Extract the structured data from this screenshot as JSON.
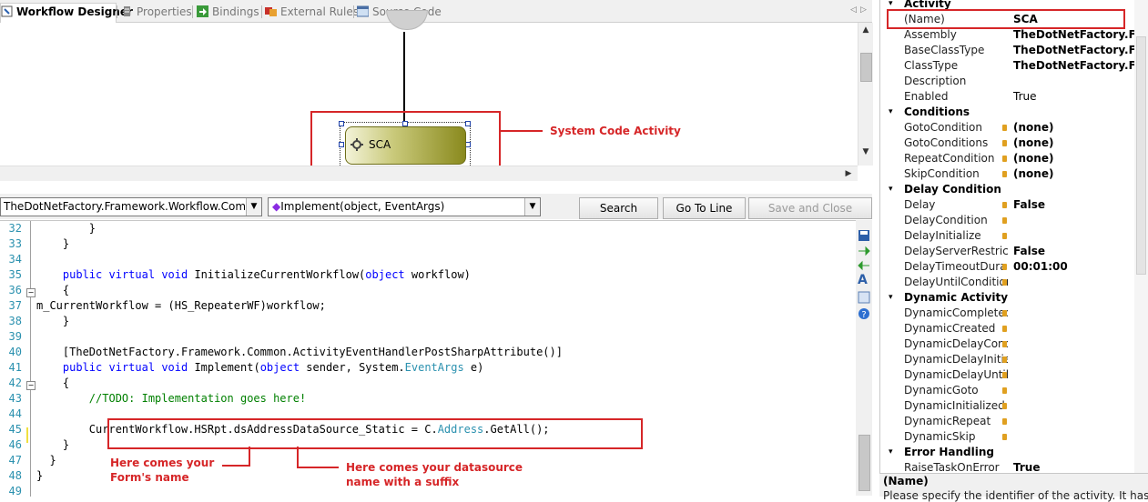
{
  "tabs": [
    {
      "label": "Workflow Designer",
      "active": true
    },
    {
      "label": "Properties",
      "active": false
    },
    {
      "label": "Bindings",
      "active": false
    },
    {
      "label": "External Rules",
      "active": false
    },
    {
      "label": "Source Code",
      "active": false
    }
  ],
  "designer": {
    "activity_label": "SCA",
    "annotation": "System Code Activity"
  },
  "toolbar": {
    "class_combo": "TheDotNetFactory.Framework.Workflow.Comr",
    "method_combo": "Implement(object, EventArgs)",
    "search_label": "Search",
    "goto_label": "Go To Line",
    "save_close_label": "Save and Close"
  },
  "code": {
    "lines": [
      {
        "n": "32",
        "text": "        }"
      },
      {
        "n": "33",
        "text": "    }"
      },
      {
        "n": "34",
        "text": ""
      },
      {
        "n": "35",
        "text": "    public virtual void InitializeCurrentWorkflow(object workflow)"
      },
      {
        "n": "36",
        "text": "    {"
      },
      {
        "n": "37",
        "text": "m_CurrentWorkflow = (HS_RepeaterWF)workflow;"
      },
      {
        "n": "38",
        "text": "    }"
      },
      {
        "n": "39",
        "text": ""
      },
      {
        "n": "40",
        "text": "    [TheDotNetFactory.Framework.Common.ActivityEventHandlerPostSharpAttribute()]"
      },
      {
        "n": "41",
        "text": "    public virtual void Implement(object sender, System.EventArgs e)"
      },
      {
        "n": "42",
        "text": "    {"
      },
      {
        "n": "43",
        "text": "        //TODO: Implementation goes here!"
      },
      {
        "n": "44",
        "text": ""
      },
      {
        "n": "45",
        "text": "        CurrentWorkflow.HSRpt.dsAddressDataSource_Static = C.Address.GetAll();"
      },
      {
        "n": "46",
        "text": "    }"
      },
      {
        "n": "47",
        "text": "  }"
      },
      {
        "n": "48",
        "text": "}"
      },
      {
        "n": "49",
        "text": ""
      }
    ],
    "annotation_form": "Here comes your\nForm's name",
    "annotation_ds": "Here comes your datasource\nname with a suffix"
  },
  "properties": {
    "rows": [
      {
        "kind": "cat",
        "name": "Activity"
      },
      {
        "kind": "prop",
        "name": "(Name)",
        "value": "SCA",
        "bold": true,
        "lock": false
      },
      {
        "kind": "prop",
        "name": "Assembly",
        "value": "TheDotNetFactory.Fr",
        "bold": true,
        "lock": false
      },
      {
        "kind": "prop",
        "name": "BaseClassType",
        "value": "TheDotNetFactory.Fr",
        "bold": true,
        "lock": false
      },
      {
        "kind": "prop",
        "name": "ClassType",
        "value": "TheDotNetFactory.Fr",
        "bold": true,
        "lock": false
      },
      {
        "kind": "prop",
        "name": "Description",
        "value": "",
        "bold": false,
        "lock": false
      },
      {
        "kind": "prop",
        "name": "Enabled",
        "value": "True",
        "bold": false,
        "lock": false
      },
      {
        "kind": "cat",
        "name": "Conditions"
      },
      {
        "kind": "prop",
        "name": "GotoCondition",
        "value": "(none)",
        "bold": true,
        "lock": true
      },
      {
        "kind": "prop",
        "name": "GotoConditions",
        "value": "(none)",
        "bold": true,
        "lock": true
      },
      {
        "kind": "prop",
        "name": "RepeatCondition",
        "value": "(none)",
        "bold": true,
        "lock": true
      },
      {
        "kind": "prop",
        "name": "SkipCondition",
        "value": "(none)",
        "bold": true,
        "lock": true
      },
      {
        "kind": "cat",
        "name": "Delay Condition"
      },
      {
        "kind": "prop",
        "name": "Delay",
        "value": "False",
        "bold": true,
        "lock": true
      },
      {
        "kind": "prop",
        "name": "DelayCondition",
        "value": "",
        "bold": false,
        "lock": true
      },
      {
        "kind": "prop",
        "name": "DelayInitialize",
        "value": "",
        "bold": false,
        "lock": true
      },
      {
        "kind": "prop",
        "name": "DelayServerRestric",
        "value": "False",
        "bold": true,
        "lock": false
      },
      {
        "kind": "prop",
        "name": "DelayTimeoutDura",
        "value": "00:01:00",
        "bold": true,
        "lock": true
      },
      {
        "kind": "prop",
        "name": "DelayUntilCondition",
        "value": "",
        "bold": false,
        "lock": true
      },
      {
        "kind": "cat",
        "name": "Dynamic Activity"
      },
      {
        "kind": "prop",
        "name": "DynamicCompleted",
        "value": "",
        "bold": false,
        "lock": true
      },
      {
        "kind": "prop",
        "name": "DynamicCreated",
        "value": "",
        "bold": false,
        "lock": true
      },
      {
        "kind": "prop",
        "name": "DynamicDelayCond",
        "value": "",
        "bold": false,
        "lock": true
      },
      {
        "kind": "prop",
        "name": "DynamicDelayInitia",
        "value": "",
        "bold": false,
        "lock": true
      },
      {
        "kind": "prop",
        "name": "DynamicDelayUntil",
        "value": "",
        "bold": false,
        "lock": true
      },
      {
        "kind": "prop",
        "name": "DynamicGoto",
        "value": "",
        "bold": false,
        "lock": true
      },
      {
        "kind": "prop",
        "name": "DynamicInitialized",
        "value": "",
        "bold": false,
        "lock": true
      },
      {
        "kind": "prop",
        "name": "DynamicRepeat",
        "value": "",
        "bold": false,
        "lock": true
      },
      {
        "kind": "prop",
        "name": "DynamicSkip",
        "value": "",
        "bold": false,
        "lock": true
      },
      {
        "kind": "cat",
        "name": "Error Handling"
      },
      {
        "kind": "prop",
        "name": "RaiseTaskOnError",
        "value": "True",
        "bold": true,
        "lock": false
      }
    ],
    "desc_title": "(Name)",
    "desc_text": "Please specify the identifier of the activity. It has"
  },
  "colors": {
    "accent_red": "#d62628",
    "activity_fill": "#8a8a1e"
  }
}
